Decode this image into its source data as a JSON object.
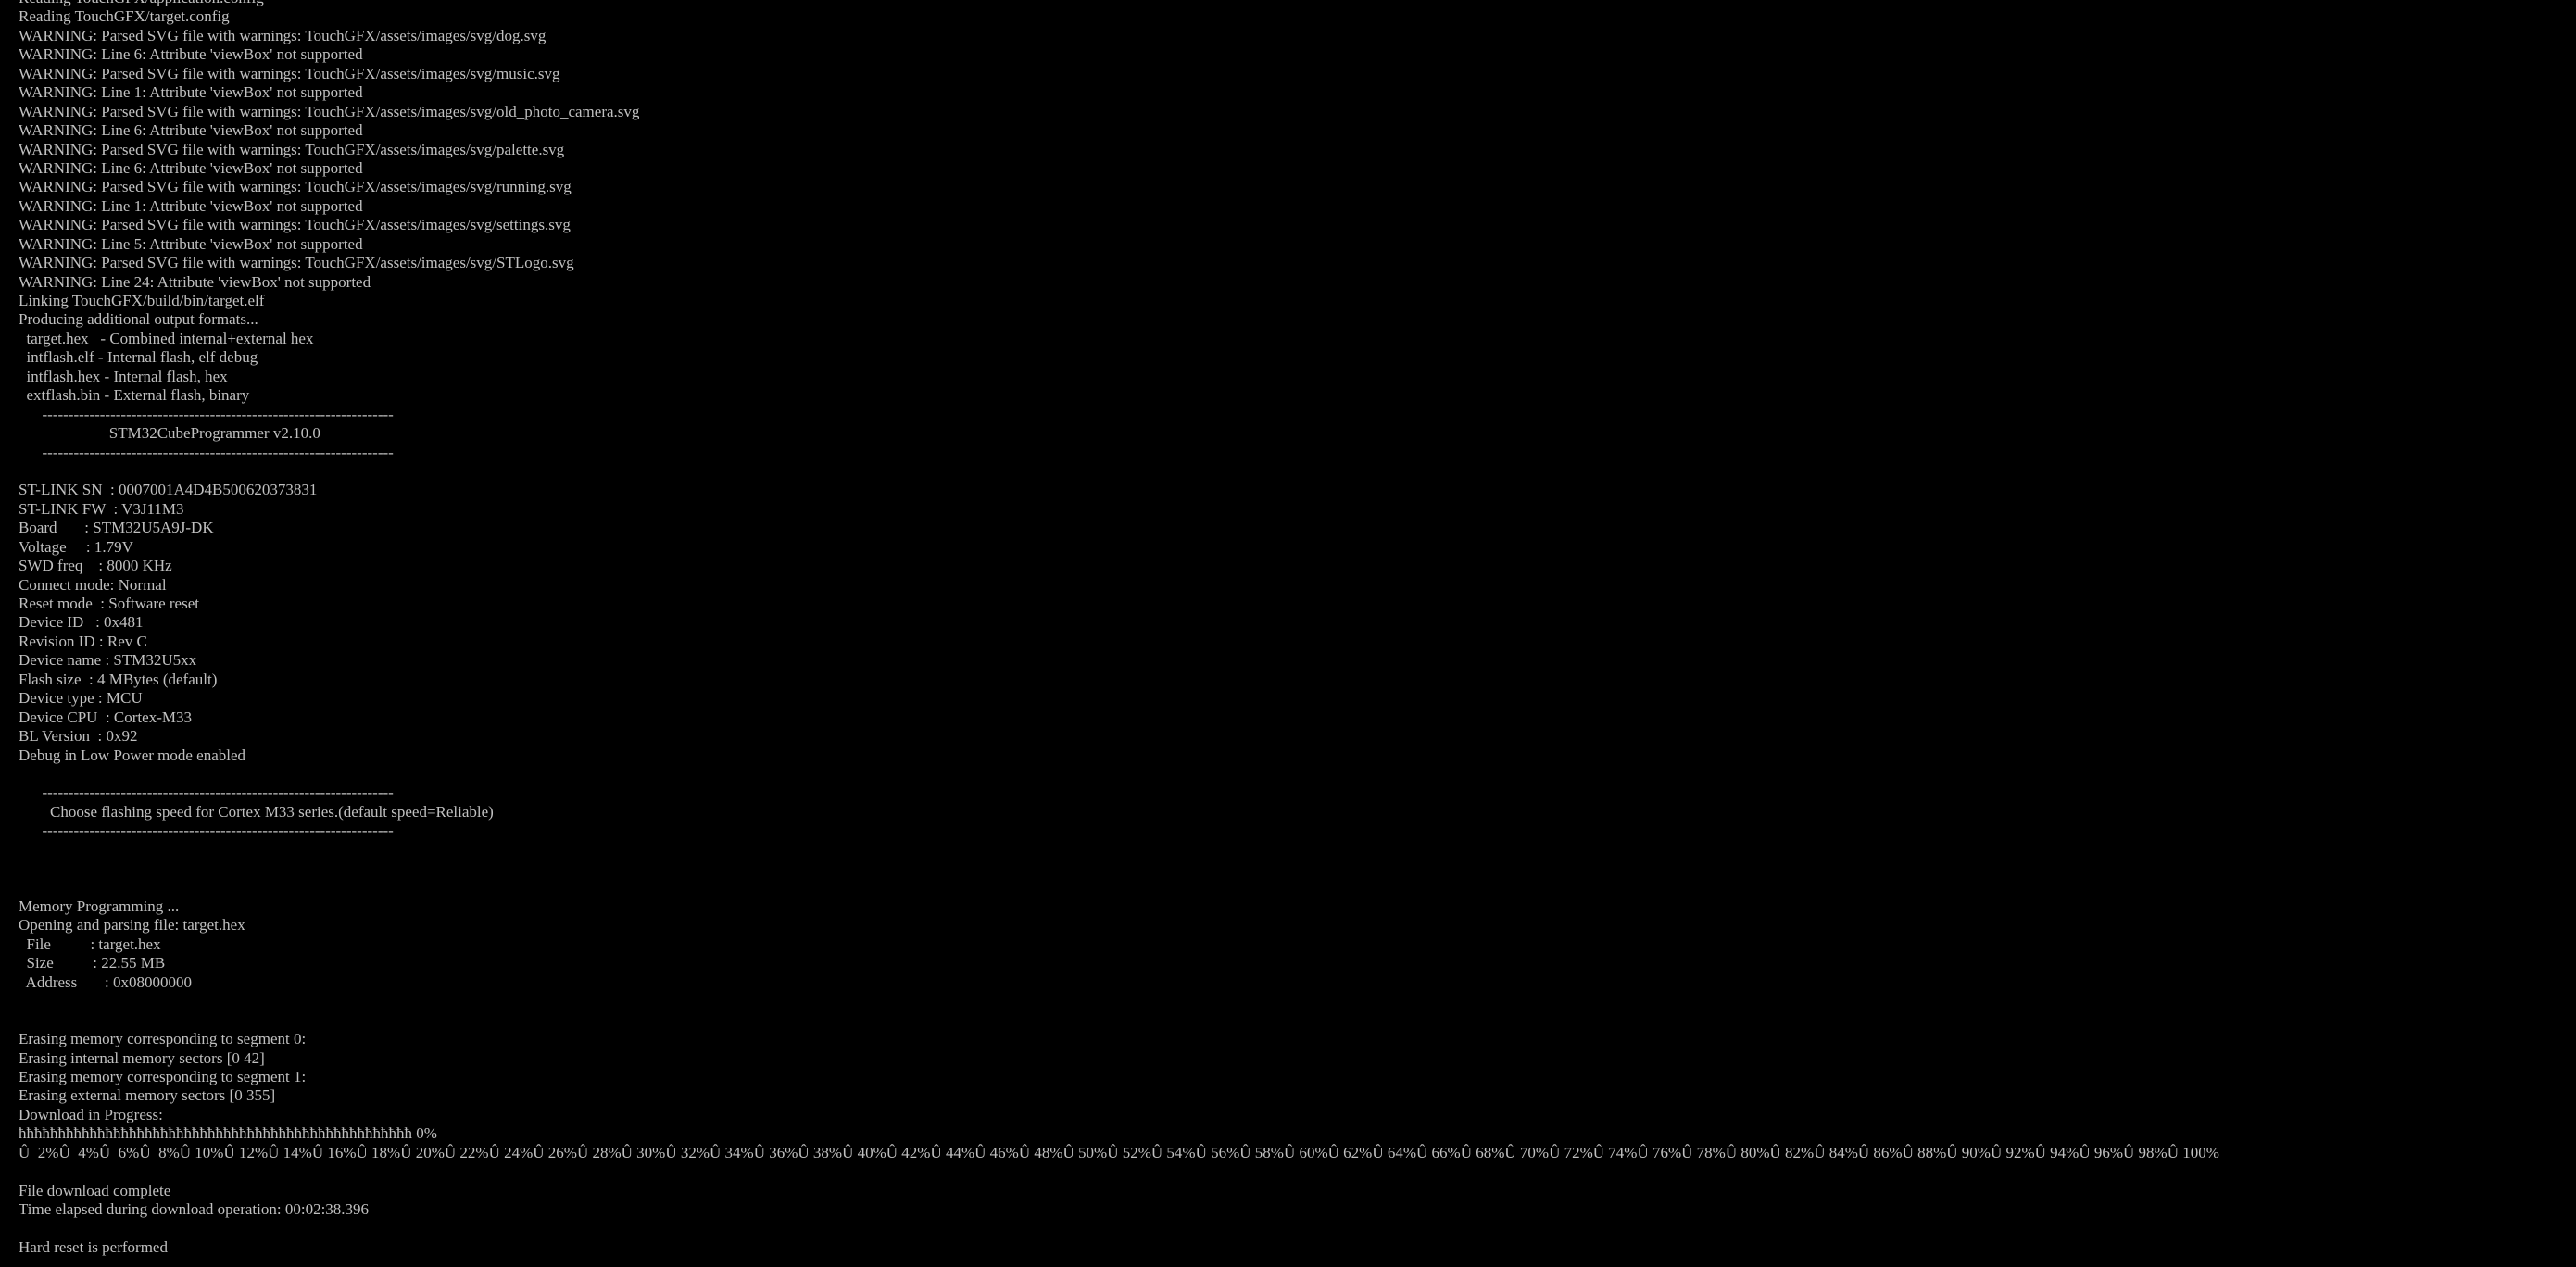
{
  "terminal": {
    "lines": [
      "Reading TouchGFX/application.config",
      "Reading TouchGFX/target.config",
      "WARNING: Parsed SVG file with warnings: TouchGFX/assets/images/svg/dog.svg",
      "WARNING: Line 6: Attribute 'viewBox' not supported",
      "WARNING: Parsed SVG file with warnings: TouchGFX/assets/images/svg/music.svg",
      "WARNING: Line 1: Attribute 'viewBox' not supported",
      "WARNING: Parsed SVG file with warnings: TouchGFX/assets/images/svg/old_photo_camera.svg",
      "WARNING: Line 6: Attribute 'viewBox' not supported",
      "WARNING: Parsed SVG file with warnings: TouchGFX/assets/images/svg/palette.svg",
      "WARNING: Line 6: Attribute 'viewBox' not supported",
      "WARNING: Parsed SVG file with warnings: TouchGFX/assets/images/svg/running.svg",
      "WARNING: Line 1: Attribute 'viewBox' not supported",
      "WARNING: Parsed SVG file with warnings: TouchGFX/assets/images/svg/settings.svg",
      "WARNING: Line 5: Attribute 'viewBox' not supported",
      "WARNING: Parsed SVG file with warnings: TouchGFX/assets/images/svg/STLogo.svg",
      "WARNING: Line 24: Attribute 'viewBox' not supported",
      "Linking TouchGFX/build/bin/target.elf",
      "Producing additional output formats...",
      "  target.hex   - Combined internal+external hex",
      "  intflash.elf - Internal flash, elf debug",
      "  intflash.hex - Internal flash, hex",
      "  extflash.bin - External flash, binary",
      "      -------------------------------------------------------------------",
      "                       STM32CubeProgrammer v2.10.0",
      "      -------------------------------------------------------------------",
      "",
      "ST-LINK SN  : 0007001A4D4B500620373831",
      "ST-LINK FW  : V3J11M3",
      "Board       : STM32U5A9J-DK",
      "Voltage     : 1.79V",
      "SWD freq    : 8000 KHz",
      "Connect mode: Normal",
      "Reset mode  : Software reset",
      "Device ID   : 0x481",
      "Revision ID : Rev C",
      "Device name : STM32U5xx",
      "Flash size  : 4 MBytes (default)",
      "Device type : MCU",
      "Device CPU  : Cortex-M33",
      "BL Version  : 0x92",
      "Debug in Low Power mode enabled",
      "",
      "      -------------------------------------------------------------------",
      "        Choose flashing speed for Cortex M33 series.(default speed=Reliable)",
      "      -------------------------------------------------------------------",
      "",
      "",
      "",
      "Memory Programming ...",
      "Opening and parsing file: target.hex",
      "  File          : target.hex",
      "  Size          : 22.55 MB",
      "  Address       : 0x08000000",
      "",
      "",
      "Erasing memory corresponding to segment 0:",
      "Erasing internal memory sectors [0 42]",
      "Erasing memory corresponding to segment 1:",
      "Erasing external memory sectors [0 355]",
      "Download in Progress:",
      "ħħħħħħħħħħħħħħħħħħħħħħħħħħħħħħħħħħħħħħħħħħħħħħħħħħ 0%",
      "Û  2%Û  4%Û  6%Û  8%Û 10%Û 12%Û 14%Û 16%Û 18%Û 20%Û 22%Û 24%Û 26%Û 28%Û 30%Û 32%Û 34%Û 36%Û 38%Û 40%Û 42%Û 44%Û 46%Û 48%Û 50%Û 52%Û 54%Û 56%Û 58%Û 60%Û 62%Û 64%Û 66%Û 68%Û 70%Û 72%Û 74%Û 76%Û 78%Û 80%Û 82%Û 84%Û 86%Û 88%Û 90%Û 92%Û 94%Û 96%Û 98%Û 100%",
      "",
      "File download complete",
      "Time elapsed during download operation: 00:02:38.396",
      "",
      "Hard reset is performed"
    ]
  }
}
